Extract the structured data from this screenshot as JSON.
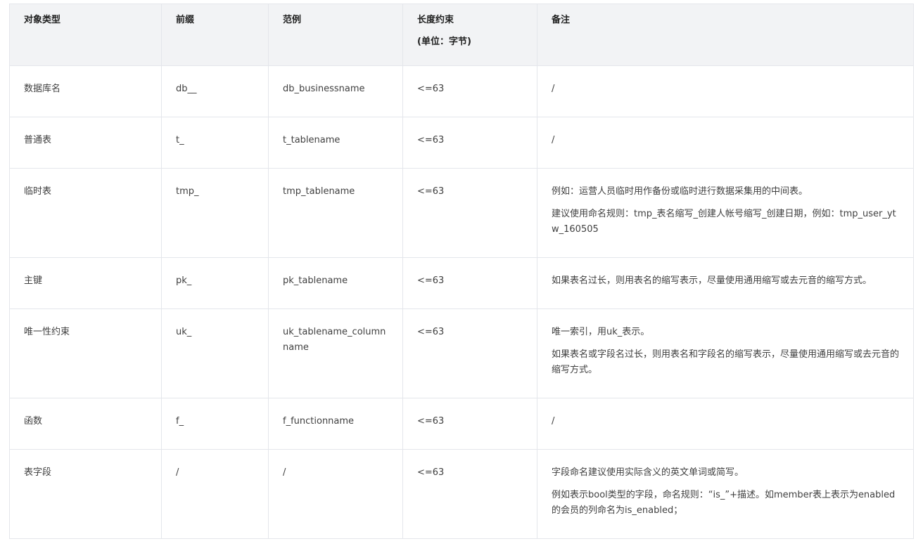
{
  "table": {
    "headers": {
      "type": "对象类型",
      "prefix": "前缀",
      "example": "范例",
      "length": "长度约束",
      "length_unit": "(单位：字节)",
      "note": "备注"
    },
    "rows": [
      {
        "type": "数据库名",
        "prefix": "db__",
        "example": "db_businessname",
        "length": "<=63",
        "notes": [
          "/"
        ]
      },
      {
        "type": "普通表",
        "prefix": "t_",
        "example": "t_tablename",
        "length": "<=63",
        "notes": [
          "/"
        ]
      },
      {
        "type": "临时表",
        "prefix": "tmp_",
        "example": "tmp_tablename",
        "length": "<=63",
        "notes": [
          "例如：运营人员临时用作备份或临时进行数据采集用的中间表。",
          "建议使用命名规则：tmp_表名缩写_创建人帐号缩写_创建日期，例如：tmp_user_ytw_160505"
        ]
      },
      {
        "type": "主键",
        "prefix": "pk_",
        "example": "pk_tablename",
        "length": "<=63",
        "notes": [
          "如果表名过长，则用表名的缩写表示，尽量使用通用缩写或去元音的缩写方式。"
        ]
      },
      {
        "type": "唯一性约束",
        "prefix": "uk_",
        "example": "uk_tablename_columnname",
        "length": "<=63",
        "notes": [
          "唯一索引，用uk_表示。",
          "如果表名或字段名过长，则用表名和字段名的缩写表示，尽量使用通用缩写或去元音的缩写方式。"
        ]
      },
      {
        "type": "函数",
        "prefix": "f_",
        "example": "f_functionname",
        "length": "<=63",
        "notes": [
          "/"
        ]
      },
      {
        "type": "表字段",
        "prefix": "/",
        "example": "/",
        "length": "<=63",
        "notes": [
          "字段命名建议使用实际含义的英文单词或简写。",
          "例如表示bool类型的字段，命名规则：“is_”+描述。如member表上表示为enabled的会员的列命名为is_enabled；"
        ]
      }
    ]
  }
}
